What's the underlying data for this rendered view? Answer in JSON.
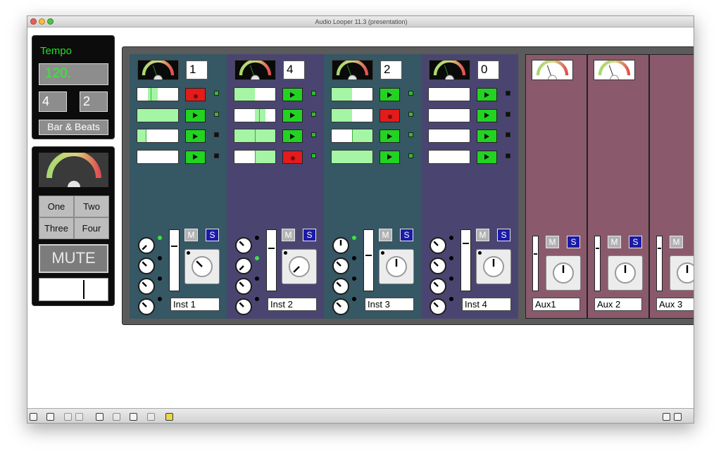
{
  "window": {
    "title": "Audio Looper 11.3 (presentation)",
    "lights": [
      "#ec5f56",
      "#f6be3c",
      "#46c645"
    ]
  },
  "tempo_panel": {
    "label": "Tempo",
    "bpm": "120.",
    "time_sig_top": "4",
    "time_sig_bottom": "2",
    "mode_button": "Bar & Beats"
  },
  "output_panel": {
    "buttons": [
      "One",
      "Two",
      "Three",
      "Four"
    ],
    "mute_label": "MUTE"
  },
  "channels": [
    {
      "name": "Inst 1",
      "count": "1",
      "bg": "#365764",
      "clips": [
        {
          "fill": [
            0.25,
            0.5
          ],
          "pos": 0.33,
          "state": "rec",
          "ind": "x"
        },
        {
          "fill": [
            0,
            1
          ],
          "pos": null,
          "state": "play",
          "ind": "x"
        },
        {
          "fill": [
            0,
            0.2
          ],
          "pos": 0.2,
          "state": "play",
          "ind": "sq"
        },
        {
          "fill": null,
          "pos": null,
          "state": "play",
          "ind": "sq"
        }
      ],
      "sends": [
        {
          "led": "on",
          "angle": 135
        },
        {
          "led": "off",
          "angle": 225
        },
        {
          "led": "off",
          "angle": 225
        },
        {
          "led": "off",
          "angle": 225
        }
      ],
      "fader": 0.75,
      "pan_angle": 225
    },
    {
      "name": "Inst 2",
      "count": "4",
      "bg": "#4a4570",
      "clips": [
        {
          "fill": [
            0,
            0.5
          ],
          "pos": null,
          "state": "play",
          "ind": "x"
        },
        {
          "fill": [
            0.5,
            0.75
          ],
          "pos": 0.6,
          "state": "play",
          "ind": "x"
        },
        {
          "fill": [
            0,
            1
          ],
          "pos": 0.5,
          "state": "play",
          "ind": "x"
        },
        {
          "fill": [
            0.5,
            1
          ],
          "pos": 0.5,
          "state": "rec",
          "ind": "x"
        }
      ],
      "sends": [
        {
          "led": "off",
          "angle": 225
        },
        {
          "led": "on",
          "angle": 135
        },
        {
          "led": "off",
          "angle": 225
        },
        {
          "led": "off",
          "angle": 225
        }
      ],
      "fader": 0.72,
      "pan_angle": 135
    },
    {
      "name": "Inst 3",
      "count": "2",
      "bg": "#365764",
      "clips": [
        {
          "fill": [
            0,
            0.5
          ],
          "pos": null,
          "state": "play",
          "ind": "x"
        },
        {
          "fill": [
            0,
            0.5
          ],
          "pos": null,
          "state": "rec",
          "ind": "x"
        },
        {
          "fill": [
            0.5,
            1
          ],
          "pos": 0.5,
          "state": "play",
          "ind": "x"
        },
        {
          "fill": [
            0,
            1
          ],
          "pos": null,
          "state": "play",
          "ind": "x"
        }
      ],
      "sends": [
        {
          "led": "on",
          "angle": 270
        },
        {
          "led": "off",
          "angle": 225
        },
        {
          "led": "off",
          "angle": 225
        },
        {
          "led": "off",
          "angle": 225
        }
      ],
      "fader": 0.6,
      "pan_angle": 180
    },
    {
      "name": "Inst 4",
      "count": "0",
      "bg": "#4a4570",
      "clips": [
        {
          "fill": null,
          "pos": null,
          "state": "play",
          "ind": "sq"
        },
        {
          "fill": null,
          "pos": null,
          "state": "play",
          "ind": "sq"
        },
        {
          "fill": null,
          "pos": null,
          "state": "play",
          "ind": "sq"
        },
        {
          "fill": null,
          "pos": null,
          "state": "play",
          "ind": "sq"
        }
      ],
      "sends": [
        {
          "led": "off",
          "angle": 225
        },
        {
          "led": "off",
          "angle": 225
        },
        {
          "led": "off",
          "angle": 225
        },
        {
          "led": "off",
          "angle": 225
        }
      ],
      "fader": 0.8,
      "pan_angle": 180
    }
  ],
  "aux": [
    {
      "name": "Aux1",
      "fader": 0.7
    },
    {
      "name": "Aux 2",
      "fader": 0.8
    },
    {
      "name": "Aux 3",
      "fader": 0.8
    }
  ],
  "labels": {
    "mute": "M",
    "solo": "S"
  },
  "colors": {
    "aux_bg": "#8a5a6c",
    "play_green": "#22d322",
    "record_red": "#e31b1b",
    "led_on": "#3fe23f",
    "indicator_green": "#2ebd2e",
    "indicator_dark": "#111111"
  },
  "bottom_icons": [
    "lock-icon",
    "presentation-icon",
    "edit-icon",
    "panel-icon",
    "bug-icon",
    "info-icon",
    "patch-icon",
    "grid-icon",
    "plugin-icon",
    "split-view-icon"
  ]
}
